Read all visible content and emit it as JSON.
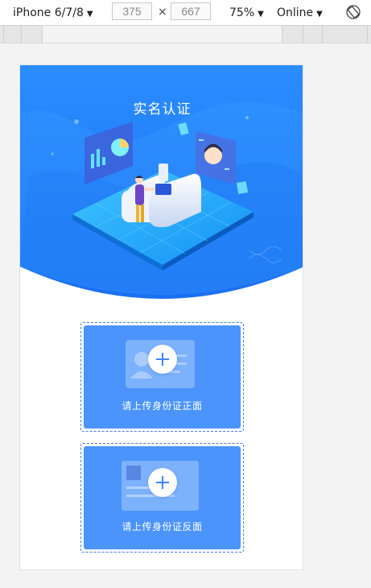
{
  "toolbar": {
    "device": "iPhone 6/7/8",
    "width": "375",
    "height": "667",
    "zoom": "75%",
    "throttle": "Online",
    "times_sign": "×"
  },
  "page": {
    "title": "实名认证"
  },
  "uploads": [
    {
      "label": "请上传身份证正面"
    },
    {
      "label": "请上传身份证反面"
    }
  ]
}
